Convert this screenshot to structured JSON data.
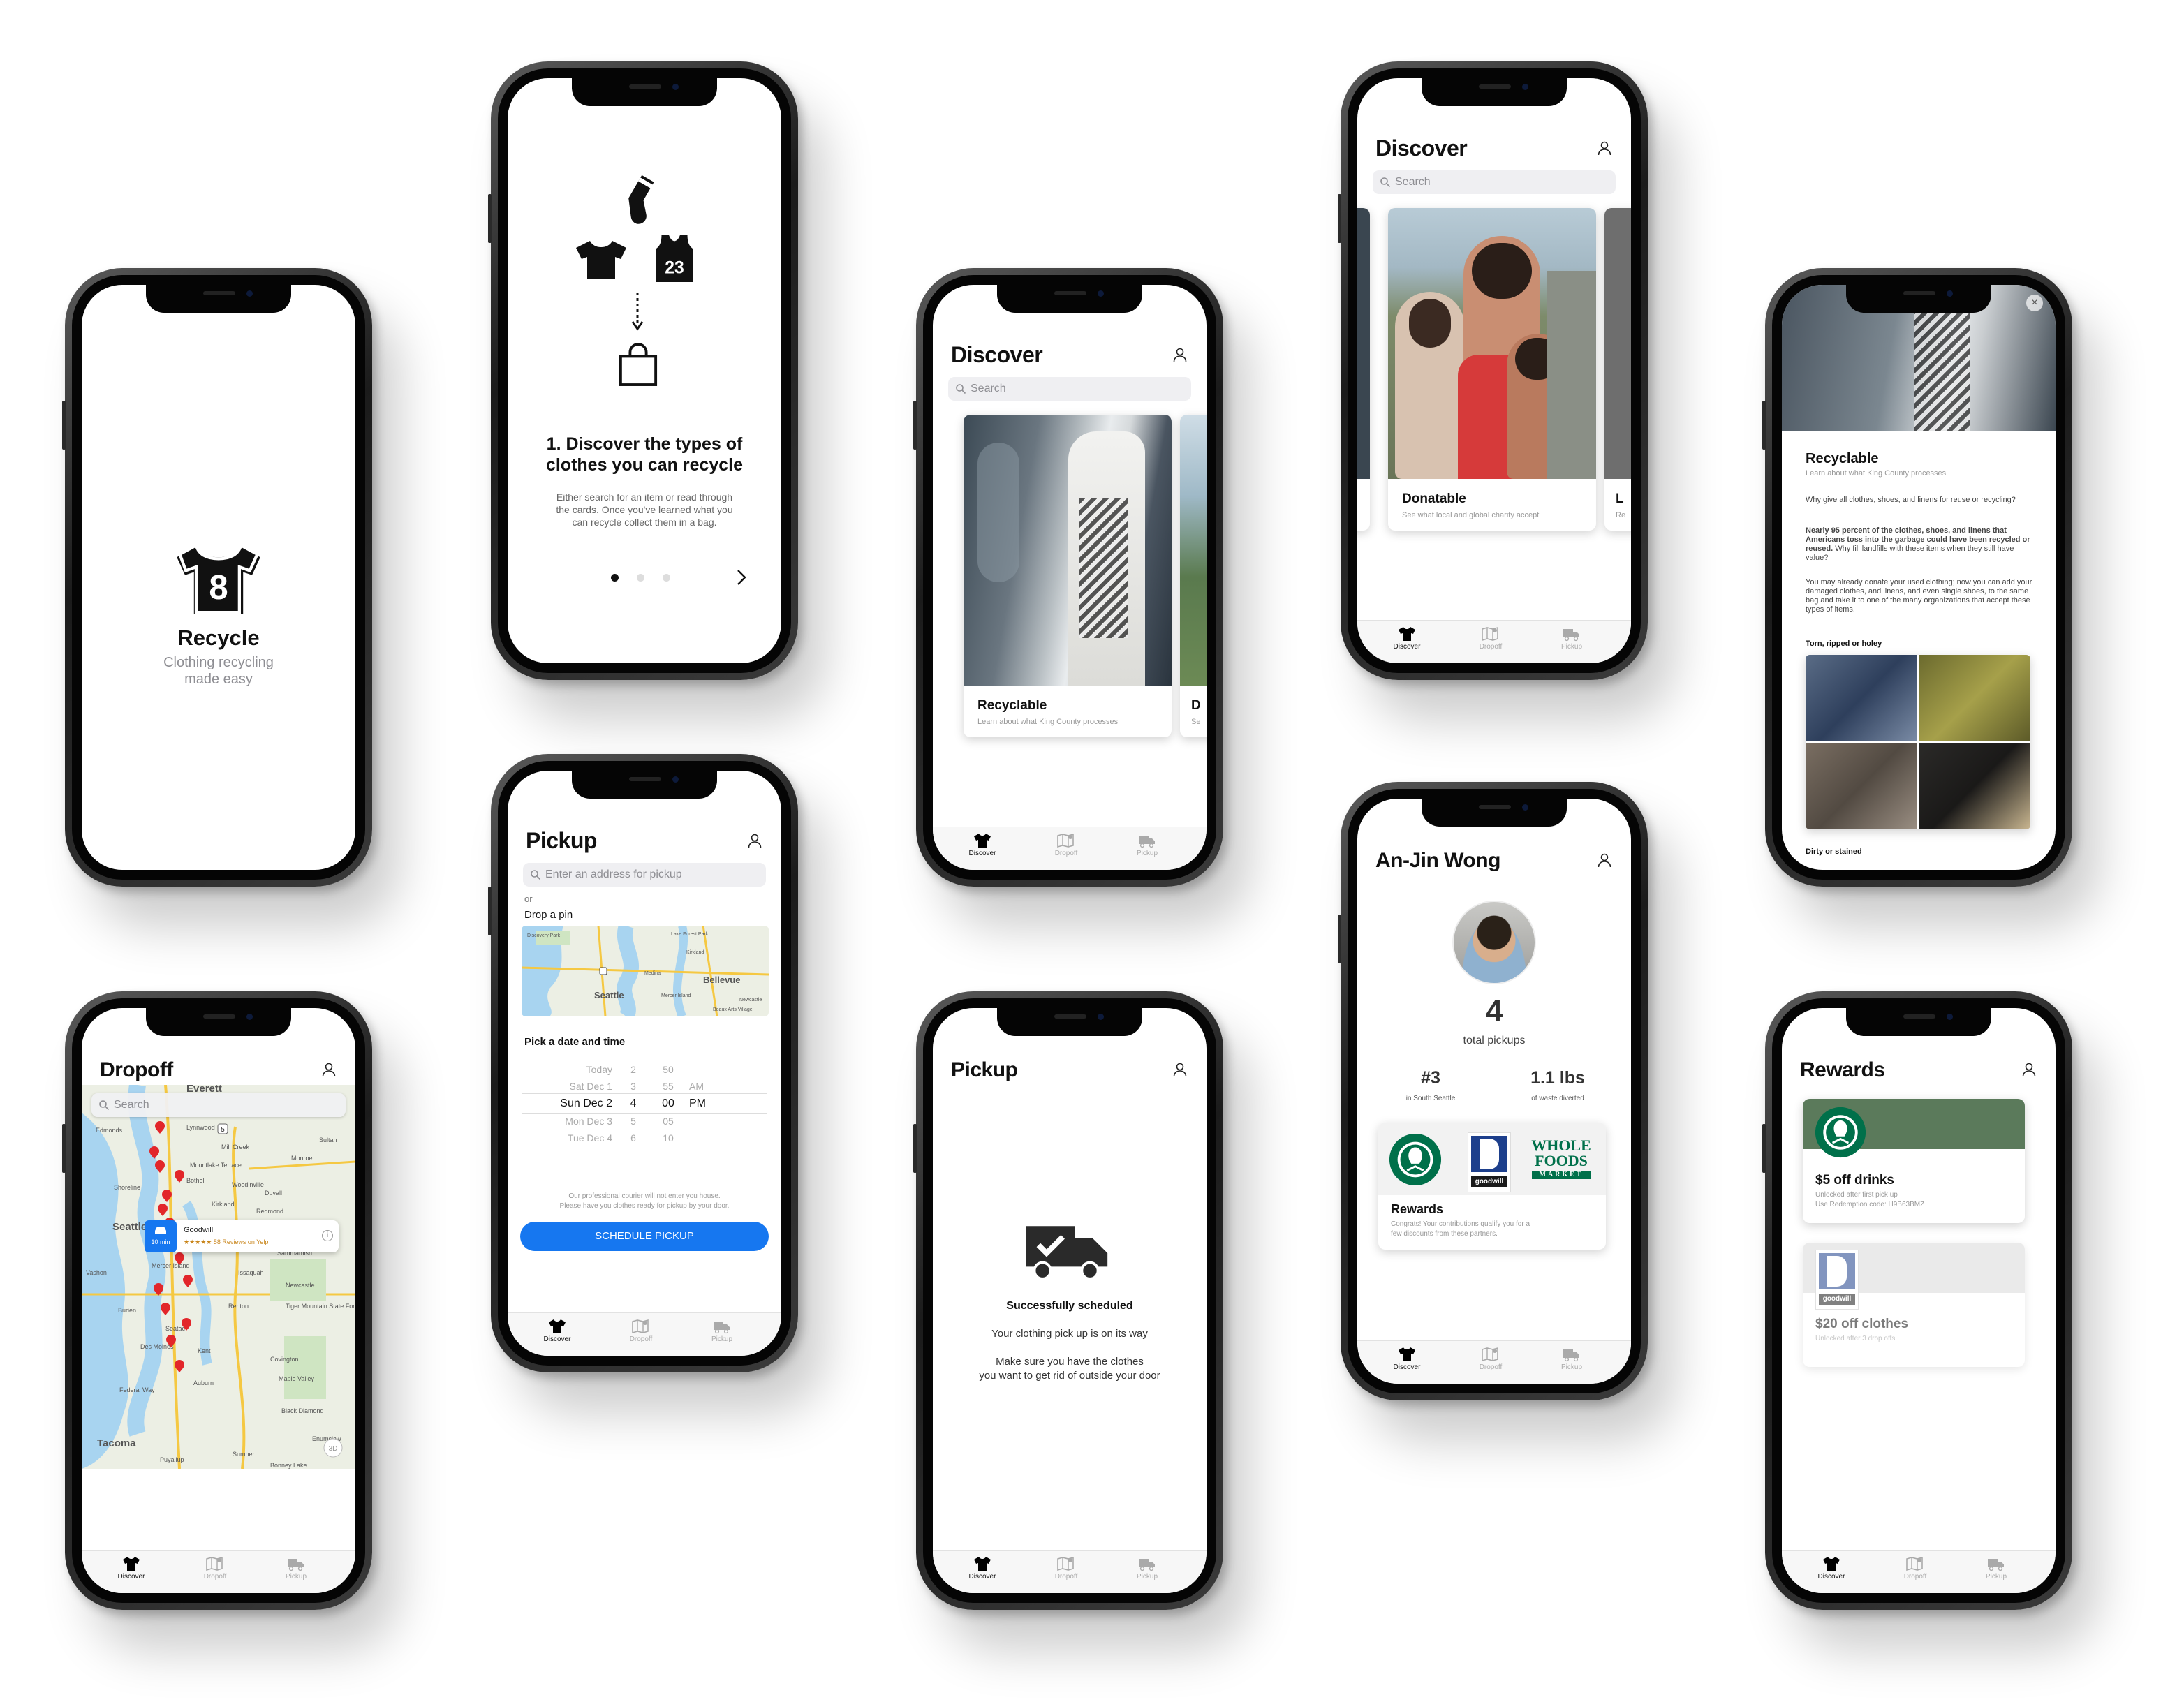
{
  "tabs": {
    "discover": "Discover",
    "dropoff": "Dropoff",
    "pickup": "Pickup"
  },
  "splash": {
    "title": "Recycle",
    "subtitle_line1": "Clothing recycling",
    "subtitle_line2": "made easy"
  },
  "onboarding": {
    "badge_number": "23",
    "heading_line1": "1. Discover the types of",
    "heading_line2": "clothes you can recycle",
    "body_line1": "Either search for an item or read through",
    "body_line2": "the cards. Once you've learned what you",
    "body_line3": "can recycle collect them in a bag.",
    "dots": 3,
    "active_dot": 1
  },
  "discover": {
    "title": "Discover",
    "search_placeholder": "Search",
    "card_recyclable_title": "Recyclable",
    "card_recyclable_sub": "Learn about what King County processes",
    "card_donatable_title": "Donatable",
    "card_donatable_sub": "See what local and global charity accept",
    "peek_letter_d": "D",
    "peek_letter_l": "L",
    "peek_sub_se": "Se",
    "peek_sub_re": "Re"
  },
  "detail": {
    "title": "Recyclable",
    "subtitle": "Learn about what King County processes",
    "para1": "Why give all clothes, shoes, and linens for reuse or recycling?",
    "para2": "Nearly 95 percent of the clothes, shoes, and linens that Americans toss into the garbage could have been recycled or reused.",
    "para2b": "Why fill landfills with these items when they still have value?",
    "para3": "You may already donate your used clothing; now you can add your damaged clothes, and linens, and even single shoes, to the same bag and take it to one of the many organizations that accept these types of items.",
    "section1": "Torn, ripped or holey",
    "section2": "Dirty or stained"
  },
  "dropoff": {
    "title": "Dropoff",
    "search_placeholder": "Search",
    "callout_name": "Goodwill",
    "callout_time": "10 min",
    "callout_reviews": "★★★★★ 58 Reviews on Yelp",
    "map_labels": [
      "Everett",
      "Edmonds",
      "Lynnwood",
      "Mill Creek",
      "Mountlake Terrace",
      "Bothell",
      "Shoreline",
      "Woodinville",
      "Duvall",
      "Kirkland",
      "Redmond",
      "Seattle",
      "Bellevue",
      "Sammamish",
      "Issaquah",
      "Renton",
      "Burien",
      "Kent",
      "Des Moines",
      "Federal Way",
      "Auburn",
      "Tacoma",
      "Puyallup",
      "Sumner",
      "Covington",
      "Maple Valley",
      "Black Diamond",
      "Enumclaw",
      "Bonney Lake",
      "Monroe",
      "Sultan",
      "Newcastle",
      "Vashon",
      "Tiger Mountain State Forest",
      "Mercer Island",
      "Seatac"
    ],
    "badge_5": "5",
    "compass": "3D"
  },
  "pickup": {
    "title": "Pickup",
    "address_placeholder": "Enter an address for pickup",
    "or_text": "or",
    "drop_pin": "Drop a pin",
    "map_labels": [
      "Discovery Park",
      "Lake Forest Park",
      "Kirkland",
      "Bellevue",
      "Medina",
      "Seattle",
      "Mercer Island",
      "Beaux Arts Village",
      "Newcastle"
    ],
    "date_heading": "Pick a date and time",
    "picker_rows": [
      {
        "day": "Today",
        "hour": "2",
        "min": "50",
        "ampm": ""
      },
      {
        "day": "Sat Dec 1",
        "hour": "3",
        "min": "55",
        "ampm": "AM"
      },
      {
        "day": "Sun Dec 2",
        "hour": "4",
        "min": "00",
        "ampm": "PM"
      },
      {
        "day": "Mon Dec 3",
        "hour": "5",
        "min": "05",
        "ampm": ""
      },
      {
        "day": "Tue Dec 4",
        "hour": "6",
        "min": "10",
        "ampm": ""
      }
    ],
    "note_line1": "Our professional courier will not enter you house.",
    "note_line2": "Please have you clothes ready for pickup by your door.",
    "button": "SCHEDULE PICKUP"
  },
  "success": {
    "title": "Pickup",
    "heading": "Successfully scheduled",
    "line1": "Your clothing pick up is on its way",
    "line2": "Make sure you have the clothes",
    "line3": "you want to get rid of outside your door"
  },
  "profile": {
    "name": "An-Jin Wong",
    "pickups": "4",
    "pickups_label": "total pickups",
    "rank": "#3",
    "rank_label": "in South Seattle",
    "weight": "1.1 lbs",
    "weight_label": "of waste diverted",
    "rewards_title": "Rewards",
    "rewards_text_line1": "Congrats! Your contributions qualify you for a",
    "rewards_text_line2": "few discounts from these partners.",
    "goodwill_word": "goodwill",
    "wf_line1": "WHOLE",
    "wf_line2": "FOODS",
    "wf_line3": "MARKET"
  },
  "rewards": {
    "title": "Rewards",
    "goodwill_word": "goodwill",
    "items": [
      {
        "title": "$5 off drinks",
        "line1": "Unlocked after first pick up",
        "line2": "Use Redemption code: H9B63BMZ"
      },
      {
        "title": "$20 off clothes",
        "line1": "Unlocked after 3 drop offs"
      }
    ]
  },
  "colors": {
    "accent_blue": "#1677f0",
    "starbucks_green": "#00704a",
    "rewards_header_green": "#5b7a5b",
    "goodwill_blue": "#1d3f8c",
    "map_water": "#a8d4f0",
    "pin_red": "#e2262a"
  }
}
